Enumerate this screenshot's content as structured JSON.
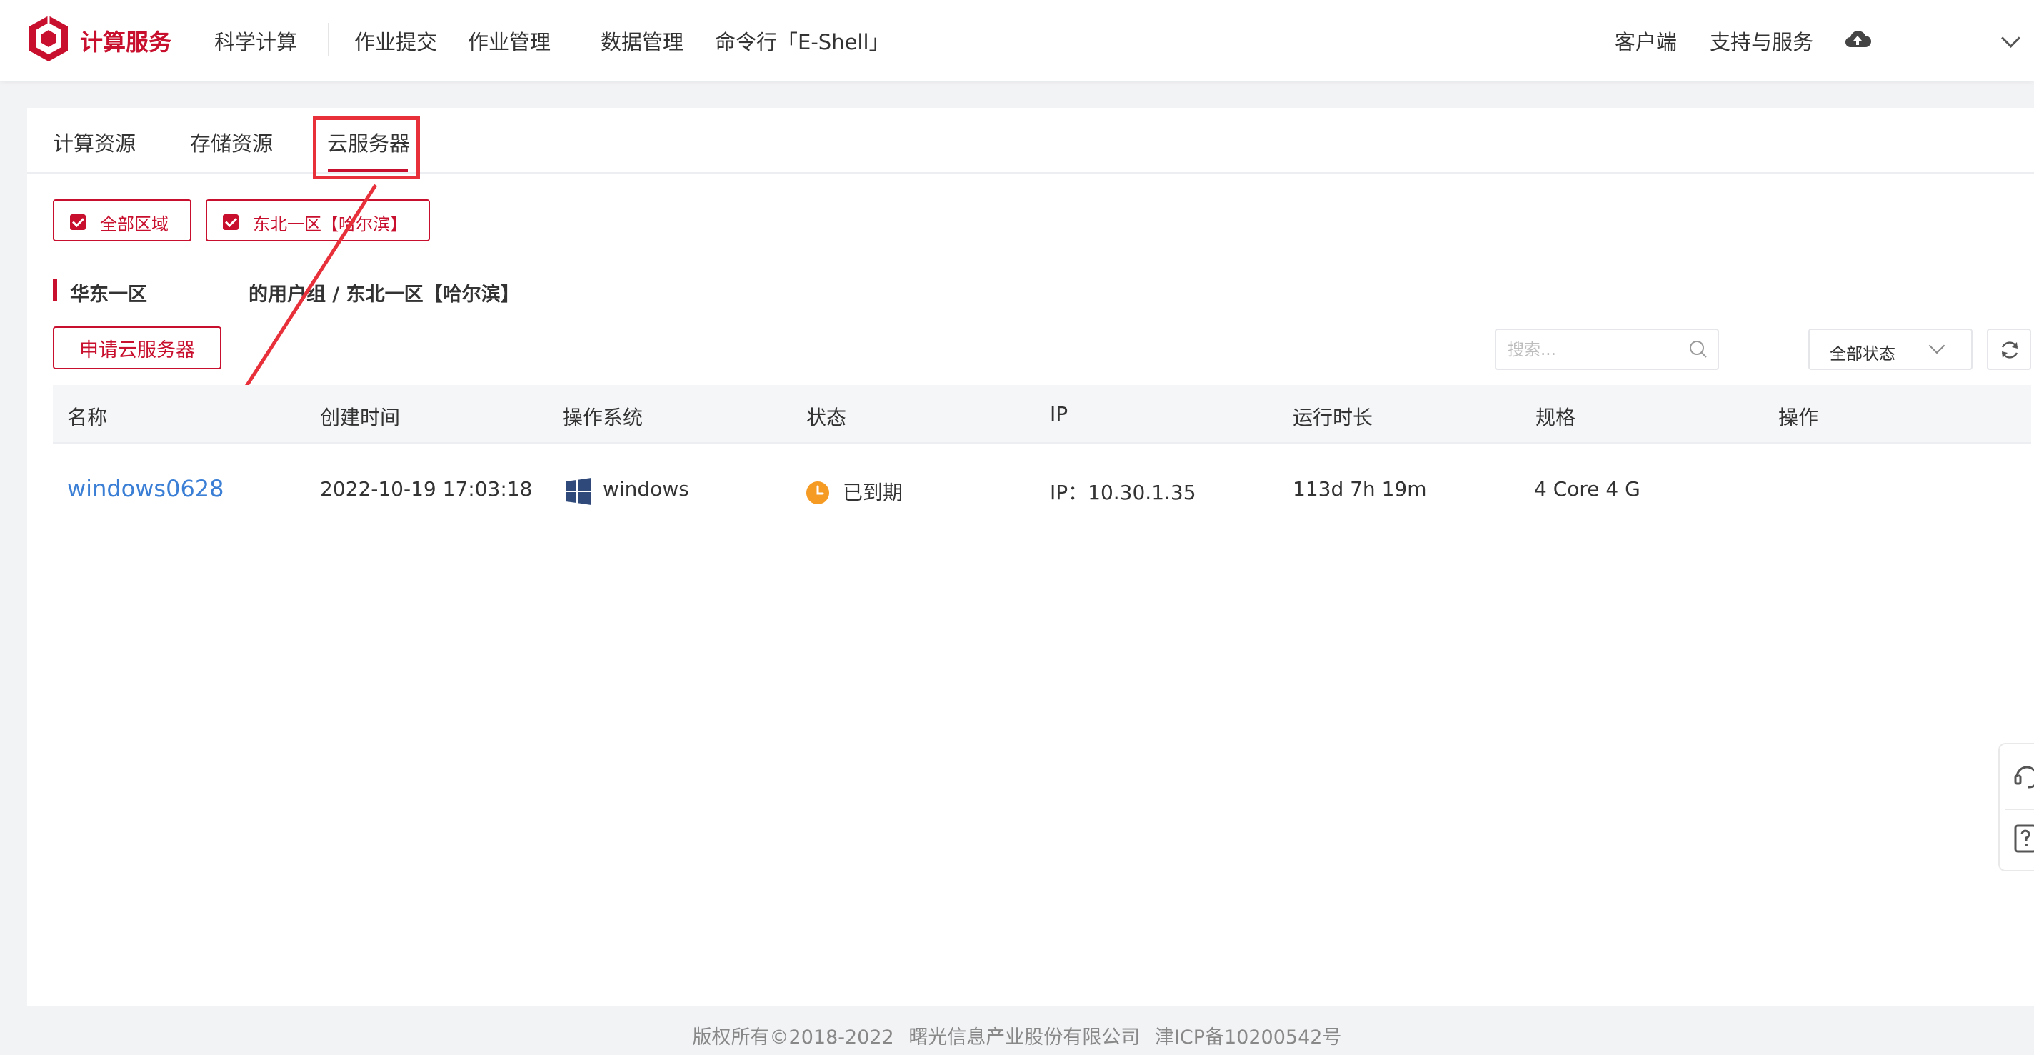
{
  "header": {
    "brand": "计算服务",
    "nav": [
      "科学计算",
      "作业提交",
      "作业管理",
      "数据管理",
      "命令行「E-Shell」"
    ],
    "right": [
      "客户端",
      "支持与服务"
    ]
  },
  "tabs": [
    "计算资源",
    "存储资源",
    "云服务器"
  ],
  "active_tab": "云服务器",
  "regions": [
    "全部区域",
    "东北一区【哈尔滨】"
  ],
  "section": {
    "title_left": "华东一区",
    "title_right": "的用户组 / 东北一区【哈尔滨】"
  },
  "toolbar": {
    "apply_label": "申请云服务器",
    "search_placeholder": "搜索...",
    "status_filter": "全部状态"
  },
  "table": {
    "columns": [
      "名称",
      "创建时间",
      "操作系统",
      "状态",
      "IP",
      "运行时长",
      "规格",
      "操作"
    ],
    "rows": [
      {
        "name": "windows0628",
        "created": "2022-10-19 17:03:18",
        "os": "windows",
        "status": "已到期",
        "ip": "IP：10.30.1.35",
        "uptime": "113d 7h 19m",
        "spec": "4 Core 4 G"
      }
    ]
  },
  "footer": {
    "copyright": "版权所有©2018-2022",
    "company": "曙光信息产业股份有限公司",
    "icp": "津ICP备10200542号"
  },
  "colors": {
    "brand_red": "#c8102e",
    "link_blue": "#3a7fd5",
    "status_orange": "#f59a23",
    "annotation_red": "#e8303a"
  }
}
